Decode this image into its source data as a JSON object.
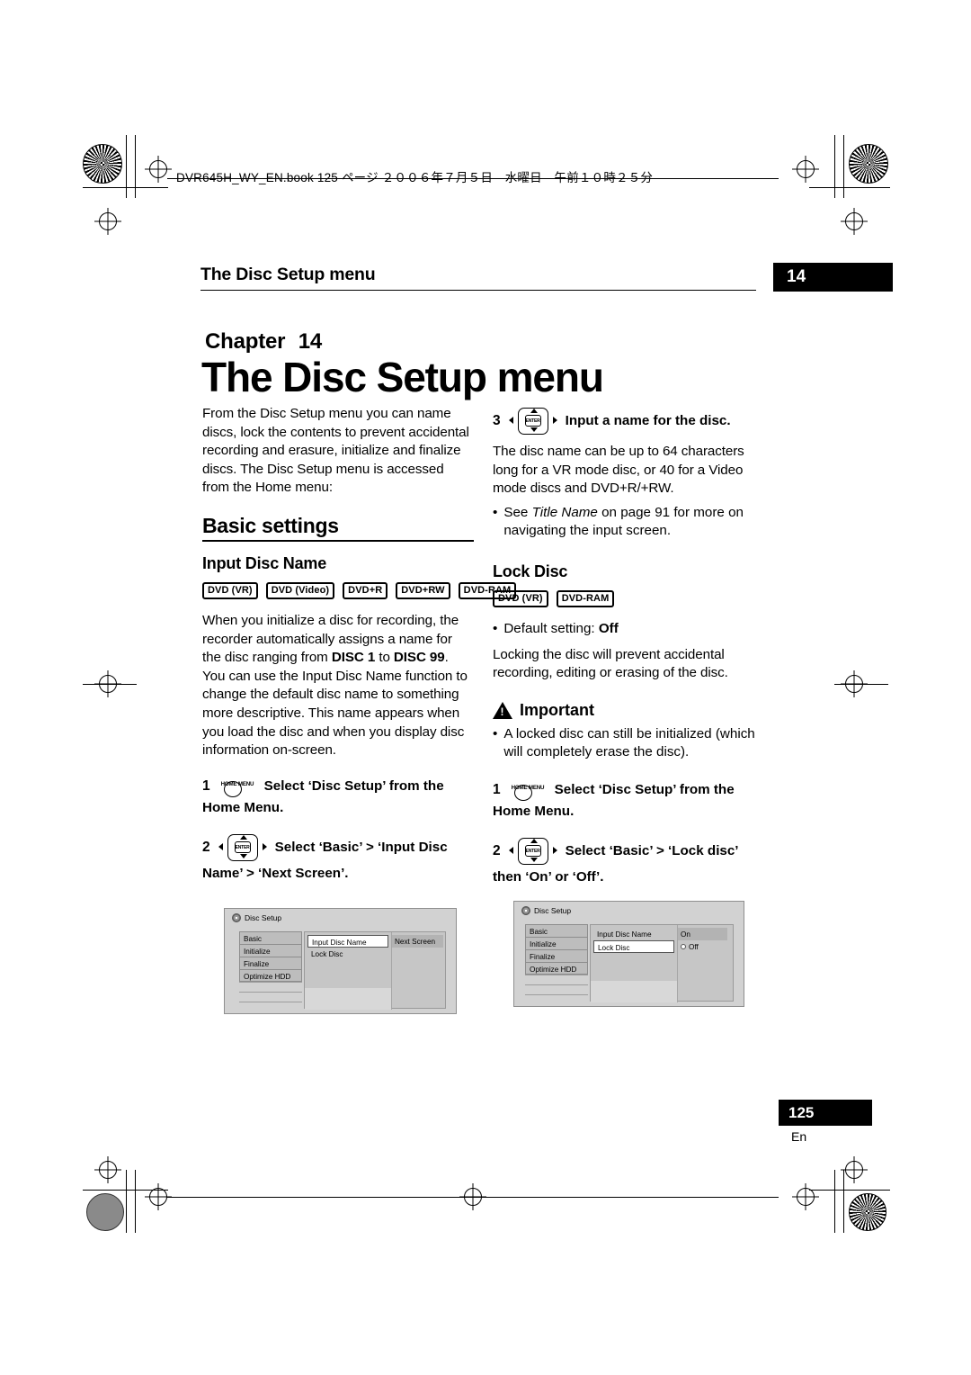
{
  "header": {
    "file_line": "DVR645H_WY_EN.book 125 ページ ２００６年７月５日　水曜日　午前１０時２５分"
  },
  "running_head": {
    "title": "The Disc Setup menu",
    "chapter_number": "14"
  },
  "chapter": {
    "label": "Chapter",
    "number": "14",
    "title": "The Disc Setup menu"
  },
  "left_column": {
    "intro": "From the Disc Setup menu you can name discs, lock the contents to prevent accidental recording and erasure, initialize and finalize discs. The Disc Setup menu is accessed from the Home menu:",
    "section_heading": "Basic settings",
    "input_disc_name": {
      "heading": "Input Disc Name",
      "badges": [
        "DVD (VR)",
        "DVD (Video)",
        "DVD+R",
        "DVD+RW",
        "DVD-RAM"
      ],
      "body_part1": "When you initialize a disc for recording, the recorder automatically assigns a name for the disc ranging from ",
      "body_disc1": "DISC 1",
      "body_to": " to ",
      "body_disc99": "DISC 99",
      "body_part2": ". You can use the Input Disc Name function to change the default disc name to something more descriptive. This name appears when you load the disc and when you display disc information on-screen.",
      "step1_num": "1",
      "step1_key": "HOME MENU",
      "step1_text": "Select ‘Disc Setup’ from the Home Menu.",
      "step2_num": "2",
      "step2_key": "ENTER",
      "step2_text": "Select ‘Basic’ > ‘Input Disc Name’ > ‘Next Screen’."
    },
    "osd": {
      "title": "Disc Setup",
      "menu": [
        "Basic",
        "Initialize",
        "Finalize",
        "Optimize HDD"
      ],
      "col2": [
        "Input Disc Name",
        "Lock Disc"
      ],
      "col3": [
        "Next Screen"
      ]
    }
  },
  "right_column": {
    "step3_num": "3",
    "step3_key": "ENTER",
    "step3_title": "Input a name for the disc.",
    "step3_body": "The disc name can be up to 64 characters long for a VR mode disc, or 40 for a Video mode discs and DVD+R/+RW.",
    "bullet_see_pre": "See ",
    "bullet_see_italic": "Title Name",
    "bullet_see_post": " on page 91 for more on navigating the input screen.",
    "lock_disc": {
      "heading": "Lock Disc",
      "badges": [
        "DVD (VR)",
        "DVD-RAM"
      ],
      "default_setting_label": "Default setting: ",
      "default_setting_value": "Off",
      "body": "Locking the disc will prevent accidental recording, editing or erasing of the disc.",
      "important_label": "Important",
      "important_bullet": "A locked disc can still be initialized (which will completely erase the disc).",
      "step1_num": "1",
      "step1_key": "HOME MENU",
      "step1_text": "Select ‘Disc Setup’ from the Home Menu.",
      "step2_num": "2",
      "step2_key": "ENTER",
      "step2_text": "Select ‘Basic’ > ‘Lock disc’ then ‘On’ or ‘Off’."
    },
    "osd": {
      "title": "Disc Setup",
      "menu": [
        "Basic",
        "Initialize",
        "Finalize",
        "Optimize HDD"
      ],
      "col2": [
        "Input Disc Name",
        "Lock Disc"
      ],
      "col3_on": "On",
      "col3_off": "Off"
    }
  },
  "footer": {
    "page_number": "125",
    "language": "En"
  }
}
